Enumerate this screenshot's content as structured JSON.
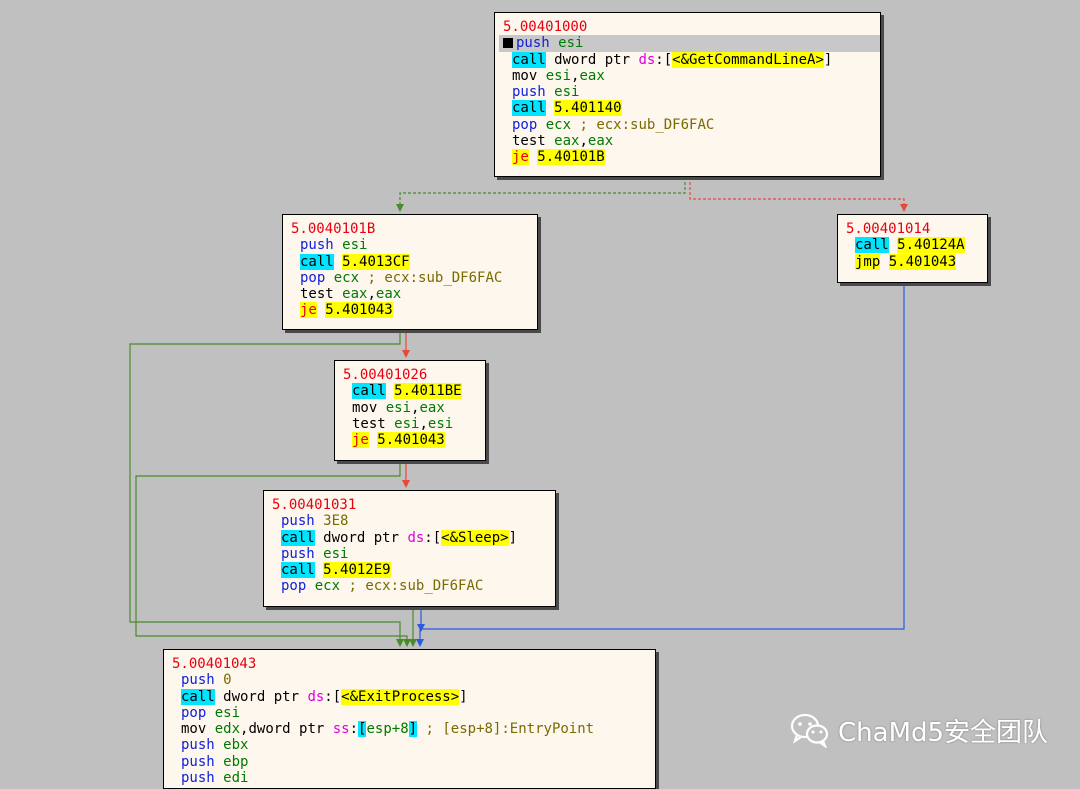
{
  "blocks": [
    {
      "id": "b-401000",
      "address": "5.00401000",
      "lines": [
        [
          {
            "t": "push",
            "c": "mn-push"
          },
          {
            "t": " "
          },
          {
            "t": "esi",
            "c": "reg"
          }
        ],
        [
          {
            "t": "call",
            "c": "mn-call"
          },
          {
            "t": " dword ptr ",
            "c": "kw"
          },
          {
            "t": "ds",
            "c": "seg"
          },
          {
            "t": ":[",
            "c": "brk"
          },
          {
            "t": "<&GetCommandLineA>",
            "c": "tgt"
          },
          {
            "t": "]",
            "c": "brk"
          }
        ],
        [
          {
            "t": "mov",
            "c": "mn"
          },
          {
            "t": " "
          },
          {
            "t": "esi",
            "c": "reg"
          },
          {
            "t": ",",
            "c": "kw"
          },
          {
            "t": "eax",
            "c": "reg"
          }
        ],
        [
          {
            "t": "push",
            "c": "mn-push"
          },
          {
            "t": " "
          },
          {
            "t": "esi",
            "c": "reg"
          }
        ],
        [
          {
            "t": "call",
            "c": "mn-call"
          },
          {
            "t": " "
          },
          {
            "t": "5.401140",
            "c": "tgt"
          }
        ],
        [
          {
            "t": "pop",
            "c": "mn-pop"
          },
          {
            "t": " "
          },
          {
            "t": "ecx",
            "c": "reg"
          },
          {
            "t": " ; ecx:sub_DF6FAC",
            "c": "cmt"
          }
        ],
        [
          {
            "t": "test",
            "c": "mn"
          },
          {
            "t": " "
          },
          {
            "t": "eax",
            "c": "reg"
          },
          {
            "t": ",",
            "c": "kw"
          },
          {
            "t": "eax",
            "c": "reg"
          }
        ],
        [
          {
            "t": "je",
            "c": "mn-je"
          },
          {
            "t": " "
          },
          {
            "t": "5.40101B",
            "c": "tgt"
          }
        ]
      ]
    },
    {
      "id": "b-40101b",
      "address": "5.0040101B",
      "lines": [
        [
          {
            "t": "push",
            "c": "mn-push"
          },
          {
            "t": " "
          },
          {
            "t": "esi",
            "c": "reg"
          }
        ],
        [
          {
            "t": "call",
            "c": "mn-call"
          },
          {
            "t": " "
          },
          {
            "t": "5.4013CF",
            "c": "tgt"
          }
        ],
        [
          {
            "t": "pop",
            "c": "mn-pop"
          },
          {
            "t": " "
          },
          {
            "t": "ecx",
            "c": "reg"
          },
          {
            "t": " ; ecx:sub_DF6FAC",
            "c": "cmt"
          }
        ],
        [
          {
            "t": "test",
            "c": "mn"
          },
          {
            "t": " "
          },
          {
            "t": "eax",
            "c": "reg"
          },
          {
            "t": ",",
            "c": "kw"
          },
          {
            "t": "eax",
            "c": "reg"
          }
        ],
        [
          {
            "t": "je",
            "c": "mn-je"
          },
          {
            "t": " "
          },
          {
            "t": "5.401043",
            "c": "tgt"
          }
        ]
      ]
    },
    {
      "id": "b-401014",
      "address": "5.00401014",
      "lines": [
        [
          {
            "t": "call",
            "c": "mn-call"
          },
          {
            "t": " "
          },
          {
            "t": "5.40124A",
            "c": "tgt"
          }
        ],
        [
          {
            "t": "jmp",
            "c": "mn-jmp"
          },
          {
            "t": " "
          },
          {
            "t": "5.401043",
            "c": "tgt"
          }
        ]
      ]
    },
    {
      "id": "b-401026",
      "address": "5.00401026",
      "lines": [
        [
          {
            "t": "call",
            "c": "mn-call"
          },
          {
            "t": " "
          },
          {
            "t": "5.4011BE",
            "c": "tgt"
          }
        ],
        [
          {
            "t": "mov",
            "c": "mn"
          },
          {
            "t": " "
          },
          {
            "t": "esi",
            "c": "reg"
          },
          {
            "t": ",",
            "c": "kw"
          },
          {
            "t": "eax",
            "c": "reg"
          }
        ],
        [
          {
            "t": "test",
            "c": "mn"
          },
          {
            "t": " "
          },
          {
            "t": "esi",
            "c": "reg"
          },
          {
            "t": ",",
            "c": "kw"
          },
          {
            "t": "esi",
            "c": "reg"
          }
        ],
        [
          {
            "t": "je",
            "c": "mn-je"
          },
          {
            "t": " "
          },
          {
            "t": "5.401043",
            "c": "tgt"
          }
        ]
      ]
    },
    {
      "id": "b-401031",
      "address": "5.00401031",
      "lines": [
        [
          {
            "t": "push",
            "c": "mn-push"
          },
          {
            "t": " "
          },
          {
            "t": "3E8",
            "c": "imm"
          }
        ],
        [
          {
            "t": "call",
            "c": "mn-call"
          },
          {
            "t": " dword ptr ",
            "c": "kw"
          },
          {
            "t": "ds",
            "c": "seg"
          },
          {
            "t": ":[",
            "c": "brk"
          },
          {
            "t": "<&Sleep>",
            "c": "tgt"
          },
          {
            "t": "]",
            "c": "brk"
          }
        ],
        [
          {
            "t": "push",
            "c": "mn-push"
          },
          {
            "t": " "
          },
          {
            "t": "esi",
            "c": "reg"
          }
        ],
        [
          {
            "t": "call",
            "c": "mn-call"
          },
          {
            "t": " "
          },
          {
            "t": "5.4012E9",
            "c": "tgt"
          }
        ],
        [
          {
            "t": "pop",
            "c": "mn-pop"
          },
          {
            "t": " "
          },
          {
            "t": "ecx",
            "c": "reg"
          },
          {
            "t": " ; ecx:sub_DF6FAC",
            "c": "cmt"
          }
        ]
      ]
    },
    {
      "id": "b-401043",
      "address": "5.00401043",
      "lines": [
        [
          {
            "t": "push",
            "c": "mn-push"
          },
          {
            "t": " "
          },
          {
            "t": "0",
            "c": "imm"
          }
        ],
        [
          {
            "t": "call",
            "c": "mn-call"
          },
          {
            "t": " dword ptr ",
            "c": "kw"
          },
          {
            "t": "ds",
            "c": "seg"
          },
          {
            "t": ":[",
            "c": "brk"
          },
          {
            "t": "<&ExitProcess>",
            "c": "tgt"
          },
          {
            "t": "]",
            "c": "brk"
          }
        ],
        [
          {
            "t": "pop",
            "c": "mn-pop"
          },
          {
            "t": " "
          },
          {
            "t": "esi",
            "c": "reg"
          }
        ],
        [
          {
            "t": "mov",
            "c": "mn"
          },
          {
            "t": " "
          },
          {
            "t": "edx",
            "c": "reg"
          },
          {
            "t": ",dword ptr ",
            "c": "kw"
          },
          {
            "t": "ss",
            "c": "seg"
          },
          {
            "t": ":",
            "c": "kw"
          },
          {
            "t": "[",
            "c": "brk-hl"
          },
          {
            "t": "esp+8",
            "c": "reg"
          },
          {
            "t": "]",
            "c": "brk-hl"
          },
          {
            "t": " ; [esp+8]:EntryPoint",
            "c": "cmt"
          }
        ],
        [
          {
            "t": "push",
            "c": "mn-push"
          },
          {
            "t": " "
          },
          {
            "t": "ebx",
            "c": "reg"
          }
        ],
        [
          {
            "t": "push",
            "c": "mn-push"
          },
          {
            "t": " "
          },
          {
            "t": "ebp",
            "c": "reg"
          }
        ],
        [
          {
            "t": "push",
            "c": "mn-push"
          },
          {
            "t": " "
          },
          {
            "t": "edi",
            "c": "reg"
          }
        ]
      ]
    }
  ],
  "edge_colors": {
    "true": "#4a8a2a",
    "false": "#e8483a",
    "jump": "#2a5ae0"
  },
  "watermark": {
    "text": "ChaMd5安全团队",
    "icon": "wechat-icon"
  }
}
